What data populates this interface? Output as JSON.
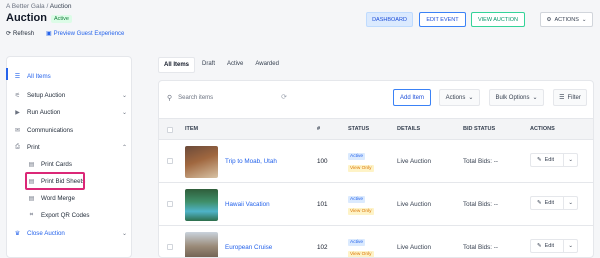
{
  "breadcrumb": {
    "parent": "A Better Gala",
    "separator": "/",
    "current": "Auction"
  },
  "page": {
    "title": "Auction",
    "status_badge": "Active"
  },
  "subbar": {
    "refresh": "Refresh",
    "preview": "Preview Guest Experience"
  },
  "header_buttons": {
    "dashboard": "DASHBOARD",
    "edit_event": "EDIT EVENT",
    "view_auction": "VIEW AUCTION",
    "actions": "ACTIONS"
  },
  "sidebar": {
    "items": [
      {
        "label": "All Items",
        "icon": "list-icon"
      },
      {
        "label": "Setup Auction",
        "icon": "sliders-icon"
      },
      {
        "label": "Run Auction",
        "icon": "play-icon"
      },
      {
        "label": "Communications",
        "icon": "chat-icon"
      },
      {
        "label": "Print",
        "icon": "printer-icon"
      },
      {
        "label": "Print Cards",
        "icon": "document-icon"
      },
      {
        "label": "Print Bid Sheets",
        "icon": "document-icon"
      },
      {
        "label": "Word Merge",
        "icon": "document-icon"
      },
      {
        "label": "Export QR Codes",
        "icon": "qr-icon"
      },
      {
        "label": "Close Auction",
        "icon": "trophy-icon"
      }
    ]
  },
  "tabs": [
    "All Items",
    "Draft",
    "Active",
    "Awarded"
  ],
  "toolbar": {
    "search_placeholder": "Search items",
    "add_item": "Add Item",
    "actions": "Actions",
    "bulk_options": "Bulk Options",
    "filter": "Filter"
  },
  "table": {
    "headers": {
      "item": "ITEM",
      "number": "#",
      "status": "STATUS",
      "details": "DETAILS",
      "bid_status": "BID STATUS",
      "actions": "ACTIONS"
    },
    "rows": [
      {
        "name": "Trip to Moab, Utah",
        "number": "100",
        "status": "Active",
        "visibility": "View Only",
        "details": "Live Auction",
        "bids": "Total Bids: --",
        "edit": "Edit"
      },
      {
        "name": "Hawaii Vacation",
        "number": "101",
        "status": "Active",
        "visibility": "View Only",
        "details": "Live Auction",
        "bids": "Total Bids: --",
        "edit": "Edit"
      },
      {
        "name": "European Cruise",
        "number": "102",
        "status": "Active",
        "visibility": "View Only",
        "details": "Live Auction",
        "bids": "Total Bids: --",
        "edit": "Edit"
      }
    ]
  },
  "colors": {
    "accent": "#2563eb",
    "highlight": "#db2777",
    "success": "#059669"
  }
}
